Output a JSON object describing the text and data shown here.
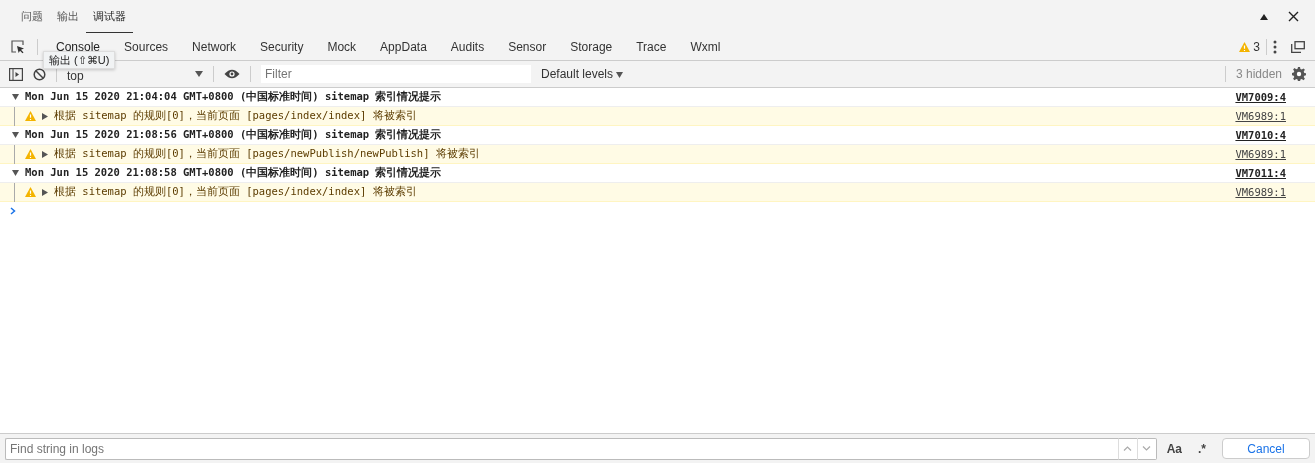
{
  "panel_tabs": [
    {
      "label": "问题",
      "selected": false
    },
    {
      "label": "输出",
      "selected": false
    },
    {
      "label": "调试器",
      "selected": true
    }
  ],
  "devtools_tabs": [
    {
      "label": "Console",
      "selected": true
    },
    {
      "label": "Sources",
      "selected": false
    },
    {
      "label": "Network",
      "selected": false
    },
    {
      "label": "Security",
      "selected": false
    },
    {
      "label": "Mock",
      "selected": false
    },
    {
      "label": "AppData",
      "selected": false
    },
    {
      "label": "Audits",
      "selected": false
    },
    {
      "label": "Sensor",
      "selected": false
    },
    {
      "label": "Storage",
      "selected": false
    },
    {
      "label": "Trace",
      "selected": false
    },
    {
      "label": "Wxml",
      "selected": false
    }
  ],
  "warning_count": "3",
  "tooltip": "输出 (⇧⌘U)",
  "toolbar": {
    "context": "top",
    "filter_placeholder": "Filter",
    "levels": "Default levels",
    "hidden": "3 hidden"
  },
  "logs": [
    {
      "kind": "group",
      "expanded": true,
      "text": "Mon Jun 15 2020 21:04:04 GMT+0800 (中国标准时间) sitemap 索引情况提示",
      "source": "VM7009:4"
    },
    {
      "kind": "warning",
      "expanded": false,
      "text": "根据 sitemap 的规则[0]，当前页面 [pages/index/index] 将被索引",
      "source": "VM6989:1"
    },
    {
      "kind": "group",
      "expanded": true,
      "text": "Mon Jun 15 2020 21:08:56 GMT+0800 (中国标准时间) sitemap 索引情况提示",
      "source": "VM7010:4"
    },
    {
      "kind": "warning",
      "expanded": false,
      "text": "根据 sitemap 的规则[0]，当前页面 [pages/newPublish/newPublish] 将被索引",
      "source": "VM6989:1"
    },
    {
      "kind": "group",
      "expanded": true,
      "text": "Mon Jun 15 2020 21:08:58 GMT+0800 (中国标准时间) sitemap 索引情况提示",
      "source": "VM7011:4"
    },
    {
      "kind": "warning",
      "expanded": false,
      "text": "根据 sitemap 的规则[0]，当前页面 [pages/index/index] 将被索引",
      "source": "VM6989:1"
    }
  ],
  "search": {
    "placeholder": "Find string in logs",
    "case_label": "Aa",
    "regex_label": ".*",
    "cancel": "Cancel"
  }
}
